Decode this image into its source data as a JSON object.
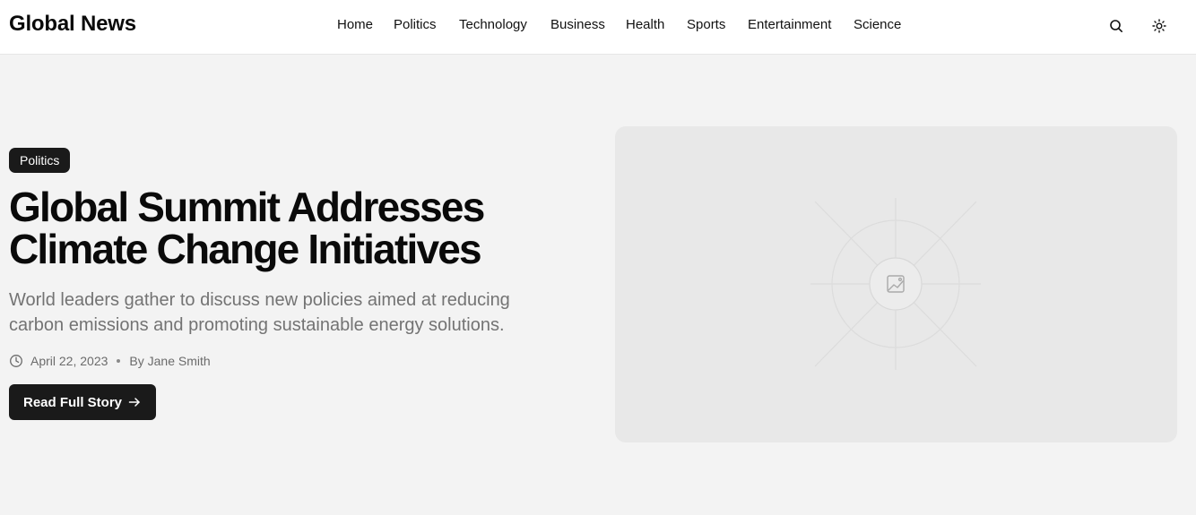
{
  "header": {
    "logo": "Global News",
    "nav": [
      "Home",
      "Politics",
      "Technology",
      "Business",
      "Health",
      "Sports",
      "Entertainment",
      "Science"
    ],
    "search_icon": "search-icon",
    "theme_icon": "sun-icon"
  },
  "hero": {
    "category": "Politics",
    "title_line1": "Global Summit Addresses",
    "title_line2": "Climate Change Initiatives",
    "subtitle_line1": "World leaders gather to discuss new policies aimed at reducing",
    "subtitle_line2": "carbon emissions and promoting sustainable energy solutions.",
    "date": "April 22, 2023",
    "author": "By Jane Smith",
    "cta_label": "Read Full Story",
    "image_icon": "image-placeholder-icon"
  },
  "colors": {
    "background": "#f3f3f3",
    "header_bg": "#ffffff",
    "dark": "#1a1a1a",
    "muted_text": "#737373",
    "image_bg": "#e8e8e8"
  }
}
